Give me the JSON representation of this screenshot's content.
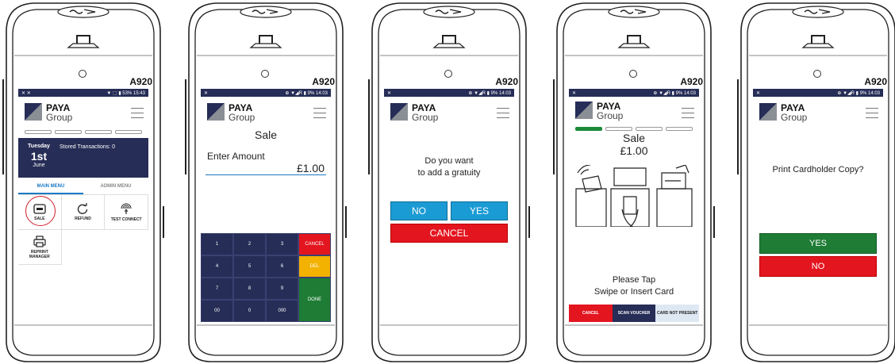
{
  "model": "A920",
  "logo": {
    "line1": "PAYA",
    "line2": "Group"
  },
  "devices": [
    {
      "status_time": "15:43",
      "status_left": "✕ ✕",
      "status_right": "▼ ⬚ ▮ 53%",
      "dashboard": {
        "day": "Tuesday",
        "date": "1st",
        "month": "June",
        "stored": "Stored Transactions: 0"
      },
      "tabs": [
        "MAIN MENU",
        "ADMIN MENU"
      ],
      "tiles": [
        "SALE",
        "REFUND",
        "TEST CONNECT",
        "REPRINT MANAGER"
      ]
    },
    {
      "status_time": "14:03",
      "status_left": "✕",
      "status_right": "⊕ ▼◢R ▮ 9%",
      "title": "Sale",
      "amount_label": "Enter Amount",
      "amount": "£1.00",
      "keys": [
        "1",
        "2",
        "3",
        "CANCEL",
        "4",
        "5",
        "6",
        "DEL",
        "7",
        "8",
        "9",
        "DONE",
        "00",
        "0",
        "000"
      ]
    },
    {
      "status_time": "14:03",
      "status_left": "✕",
      "status_right": "⊕ ▼◢R ▮ 9%",
      "question_line1": "Do you want",
      "question_line2": "to add a gratuity",
      "no": "NO",
      "yes": "YES",
      "cancel": "CANCEL"
    },
    {
      "status_time": "14:03",
      "status_left": "✕",
      "status_right": "⊕ ▼◢R ▮ 9%",
      "title": "Sale",
      "amount": "£1.00",
      "prompt_line1": "Please Tap",
      "prompt_line2": "Swipe or Insert Card",
      "bottom": [
        "CANCEL",
        "SCAN VOUCHER",
        "CARD NOT PRESENT"
      ]
    },
    {
      "status_time": "14:03",
      "status_left": "✕",
      "status_right": "⊕ ▼◢R ▮ 9%",
      "question": "Print Cardholder Copy?",
      "yes": "YES",
      "no": "NO"
    }
  ],
  "colors": {
    "navy": "#262d56",
    "red": "#e3151f",
    "green": "#1e7c35",
    "blue": "#1b9bd4",
    "yellow": "#f3b200"
  }
}
